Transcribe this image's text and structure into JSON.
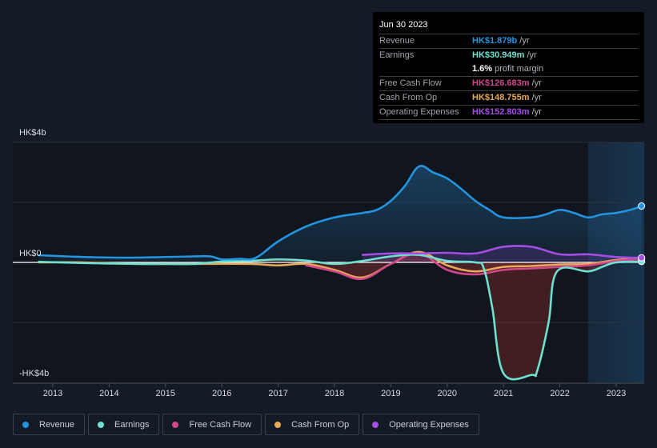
{
  "tooltip": {
    "date": "Jun 30 2023",
    "rows": [
      {
        "label": "Revenue",
        "value": "HK$1.879b",
        "unit": "/yr",
        "color": "#2394df"
      },
      {
        "label": "Earnings",
        "value": "HK$30.949m",
        "unit": "/yr",
        "color": "#6ee0d0"
      },
      {
        "label": "",
        "value": "1.6%",
        "unit": "profit margin",
        "color": "#ffffff"
      },
      {
        "label": "Free Cash Flow",
        "value": "HK$126.683m",
        "unit": "/yr",
        "color": "#d0478a"
      },
      {
        "label": "Cash From Op",
        "value": "HK$148.755m",
        "unit": "/yr",
        "color": "#e8a85a"
      },
      {
        "label": "Operating Expenses",
        "value": "HK$152.803m",
        "unit": "/yr",
        "color": "#a64de6"
      }
    ]
  },
  "legend": [
    {
      "label": "Revenue",
      "color": "#2394df"
    },
    {
      "label": "Earnings",
      "color": "#6ee0d0"
    },
    {
      "label": "Free Cash Flow",
      "color": "#d0478a"
    },
    {
      "label": "Cash From Op",
      "color": "#e8a85a"
    },
    {
      "label": "Operating Expenses",
      "color": "#a64de6"
    }
  ],
  "chart_data": {
    "type": "line",
    "title": "",
    "xlabel": "",
    "ylabel": "",
    "y_unit": "HK$ billions",
    "ylim": [
      -4,
      4
    ],
    "xlim": [
      2012.3,
      2023.5
    ],
    "y_tick_labels": [
      {
        "value": 4,
        "label": "HK$4b"
      },
      {
        "value": 0,
        "label": "HK$0"
      },
      {
        "value": -4,
        "label": "-HK$4b"
      }
    ],
    "x_tick_labels": [
      "2013",
      "2014",
      "2015",
      "2016",
      "2017",
      "2018",
      "2019",
      "2020",
      "2021",
      "2022",
      "2023"
    ],
    "x_ticks": [
      2013,
      2014,
      2015,
      2016,
      2017,
      2018,
      2019,
      2020,
      2021,
      2022,
      2023
    ],
    "forecast_region_start": 2022.5,
    "grid": true,
    "legend_position": "bottom",
    "series": [
      {
        "name": "Revenue",
        "color": "#2394df",
        "x": [
          2012.75,
          2013.25,
          2013.75,
          2014.5,
          2015.0,
          2015.5,
          2015.8,
          2016.0,
          2016.3,
          2016.6,
          2017.0,
          2017.5,
          2018.0,
          2018.5,
          2018.75,
          2019.0,
          2019.25,
          2019.5,
          2019.75,
          2020.0,
          2020.25,
          2020.5,
          2020.75,
          2021.0,
          2021.5,
          2021.75,
          2022.0,
          2022.25,
          2022.5,
          2022.75,
          2023.0,
          2023.25,
          2023.45
        ],
        "values": [
          0.24,
          0.2,
          0.17,
          0.16,
          0.18,
          0.2,
          0.2,
          0.1,
          0.12,
          0.15,
          0.7,
          1.2,
          1.5,
          1.65,
          1.75,
          2.05,
          2.55,
          3.2,
          3.0,
          2.8,
          2.45,
          2.05,
          1.75,
          1.5,
          1.5,
          1.6,
          1.75,
          1.65,
          1.5,
          1.6,
          1.65,
          1.75,
          1.879
        ]
      },
      {
        "name": "Earnings",
        "color": "#6ee0d0",
        "x": [
          2012.75,
          2013.5,
          2014.5,
          2015.0,
          2015.5,
          2016.0,
          2016.5,
          2017.0,
          2017.5,
          2018.0,
          2018.5,
          2019.0,
          2019.5,
          2020.0,
          2020.5,
          2020.65,
          2020.8,
          2021.0,
          2021.5,
          2021.6,
          2021.8,
          2021.95,
          2022.5,
          2022.75,
          2023.0,
          2023.45
        ],
        "values": [
          0.02,
          -0.02,
          -0.05,
          -0.05,
          -0.05,
          0.03,
          0.05,
          0.1,
          0.06,
          -0.05,
          0.05,
          0.2,
          0.25,
          0.05,
          0.0,
          -0.2,
          -1.5,
          -3.7,
          -3.75,
          -3.6,
          -2.0,
          -0.3,
          -0.3,
          -0.15,
          0.0,
          0.031
        ]
      },
      {
        "name": "Free Cash Flow",
        "color": "#d0478a",
        "x": [
          2017.5,
          2018.0,
          2018.5,
          2019.0,
          2019.5,
          2020.0,
          2020.5,
          2021.0,
          2021.5,
          2022.0,
          2022.5,
          2023.0,
          2023.45
        ],
        "values": [
          -0.1,
          -0.3,
          -0.55,
          -0.05,
          0.3,
          -0.25,
          -0.4,
          -0.25,
          -0.2,
          -0.15,
          -0.1,
          0.05,
          0.127
        ]
      },
      {
        "name": "Cash From Op",
        "color": "#e8a85a",
        "x": [
          2012.75,
          2013.5,
          2014.5,
          2015.5,
          2016.5,
          2017.0,
          2017.5,
          2018.0,
          2018.5,
          2019.0,
          2019.5,
          2020.0,
          2020.5,
          2021.0,
          2021.5,
          2022.0,
          2022.5,
          2023.0,
          2023.45
        ],
        "values": [
          0.0,
          0.0,
          -0.05,
          -0.05,
          -0.05,
          -0.1,
          -0.05,
          -0.25,
          -0.5,
          -0.05,
          0.35,
          -0.1,
          -0.3,
          -0.15,
          -0.12,
          -0.07,
          -0.05,
          0.08,
          0.149
        ]
      },
      {
        "name": "Operating Expenses",
        "color": "#a64de6",
        "x": [
          2018.5,
          2019.0,
          2019.5,
          2020.0,
          2020.5,
          2021.0,
          2021.5,
          2022.0,
          2022.5,
          2023.0,
          2023.45
        ],
        "values": [
          0.25,
          0.3,
          0.3,
          0.32,
          0.3,
          0.52,
          0.52,
          0.27,
          0.27,
          0.18,
          0.153
        ]
      }
    ]
  }
}
